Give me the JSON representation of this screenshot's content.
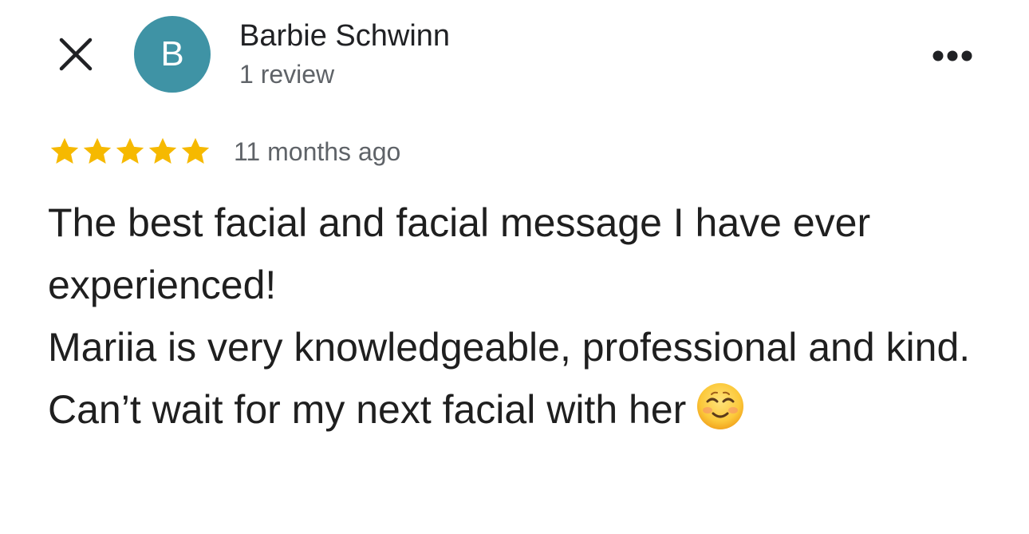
{
  "header": {
    "avatar_initial": "B",
    "avatar_color": "#3f93a5",
    "reviewer_name": "Barbie Schwinn",
    "review_count": "1 review",
    "close_icon": "close-icon",
    "more_icon": "more-options-icon"
  },
  "review": {
    "rating": 5,
    "rating_max": 5,
    "star_color": "#f6b900",
    "date": "11 months ago",
    "text_lines": [
      "The best facial and facial message I have ever experienced!",
      "Mariia is very knowledgeable, professional and kind. Can’t wait for my next facial with her"
    ],
    "emoji": "smiling-face-icon"
  }
}
